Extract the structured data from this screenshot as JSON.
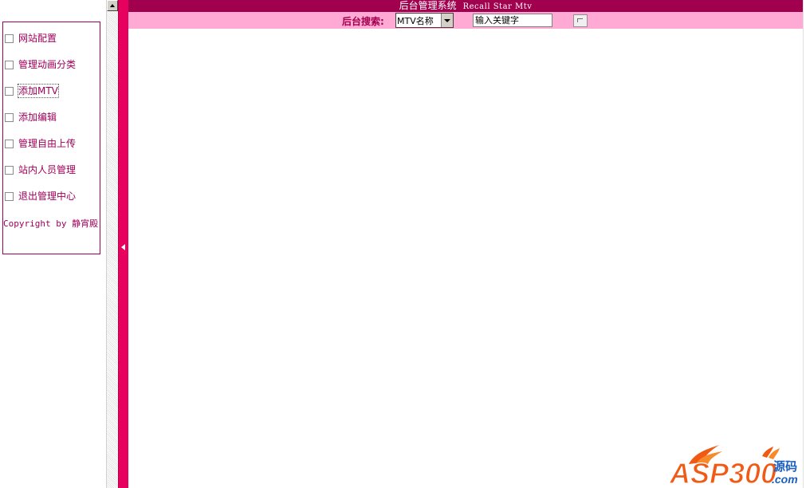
{
  "header": {
    "title_cn": "后台管理系统",
    "title_en": "Recall Star Mtv"
  },
  "search": {
    "label": "后台搜索:",
    "select_value": "MTV名称",
    "input_value": "输入关键字"
  },
  "sidebar": {
    "items": [
      {
        "label": "网站配置"
      },
      {
        "label": "管理动画分类"
      },
      {
        "label": "添加MTV"
      },
      {
        "label": "添加编辑"
      },
      {
        "label": "管理自由上传"
      },
      {
        "label": "站内人员管理"
      },
      {
        "label": "退出管理中心"
      }
    ],
    "copyright": "Copyright by 静宵殿"
  },
  "watermark": {
    "brand": "ASP300",
    "suffix": "源码",
    "domain": ".com"
  },
  "colors": {
    "brand_dark": "#a0004e",
    "brand_pink": "#e8005f",
    "search_bg": "#ffaad4",
    "logo_orange": "#f05a14",
    "logo_blue": "#1a5fc0"
  }
}
